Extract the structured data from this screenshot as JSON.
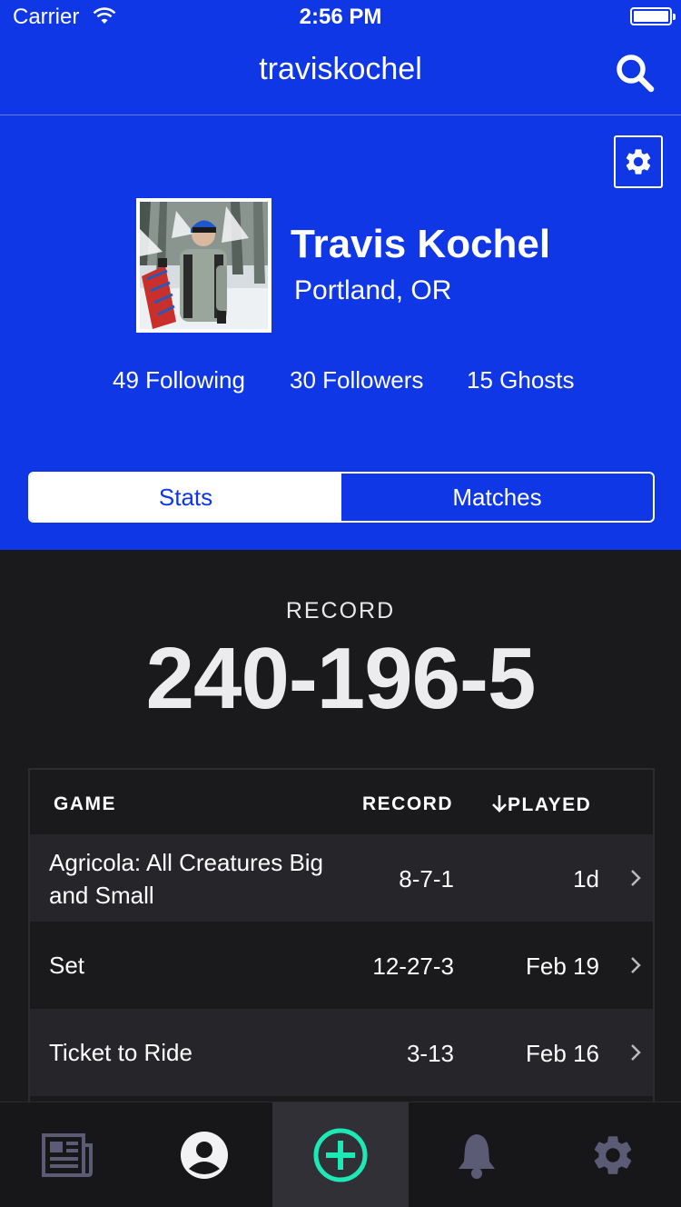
{
  "status_bar": {
    "carrier": "Carrier",
    "time": "2:56 PM"
  },
  "nav": {
    "title": "traviskochel",
    "search_icon": "search-icon",
    "settings_icon": "gear-icon"
  },
  "profile": {
    "name": "Travis Kochel",
    "location": "Portland, OR",
    "following": "49 Following",
    "followers": "30 Followers",
    "ghosts": "15 Ghosts"
  },
  "segments": {
    "stats": "Stats",
    "matches": "Matches",
    "selected": "Stats"
  },
  "record": {
    "label": "RECORD",
    "value": "240-196-5"
  },
  "table": {
    "headers": {
      "game": "GAME",
      "record": "RECORD",
      "played": "PLAYED",
      "sort_icon": "arrow-down-icon"
    },
    "rows": [
      {
        "game": "Agricola: All Creatures Big and Small",
        "record": "8-7-1",
        "played": "1d"
      },
      {
        "game": "Set",
        "record": "12-27-3",
        "played": "Feb 19"
      },
      {
        "game": "Ticket to Ride",
        "record": "3-13",
        "played": "Feb 16"
      }
    ]
  },
  "tabbar": {
    "tabs": [
      {
        "icon": "newspaper-icon"
      },
      {
        "icon": "profile-icon"
      },
      {
        "icon": "add-circle-icon",
        "active": true
      },
      {
        "icon": "bell-icon"
      },
      {
        "icon": "gear-icon"
      }
    ]
  },
  "colors": {
    "brand_blue": "#0f37e6",
    "accent_teal": "#1de9b6",
    "dark_bg": "#1a1a1d"
  }
}
